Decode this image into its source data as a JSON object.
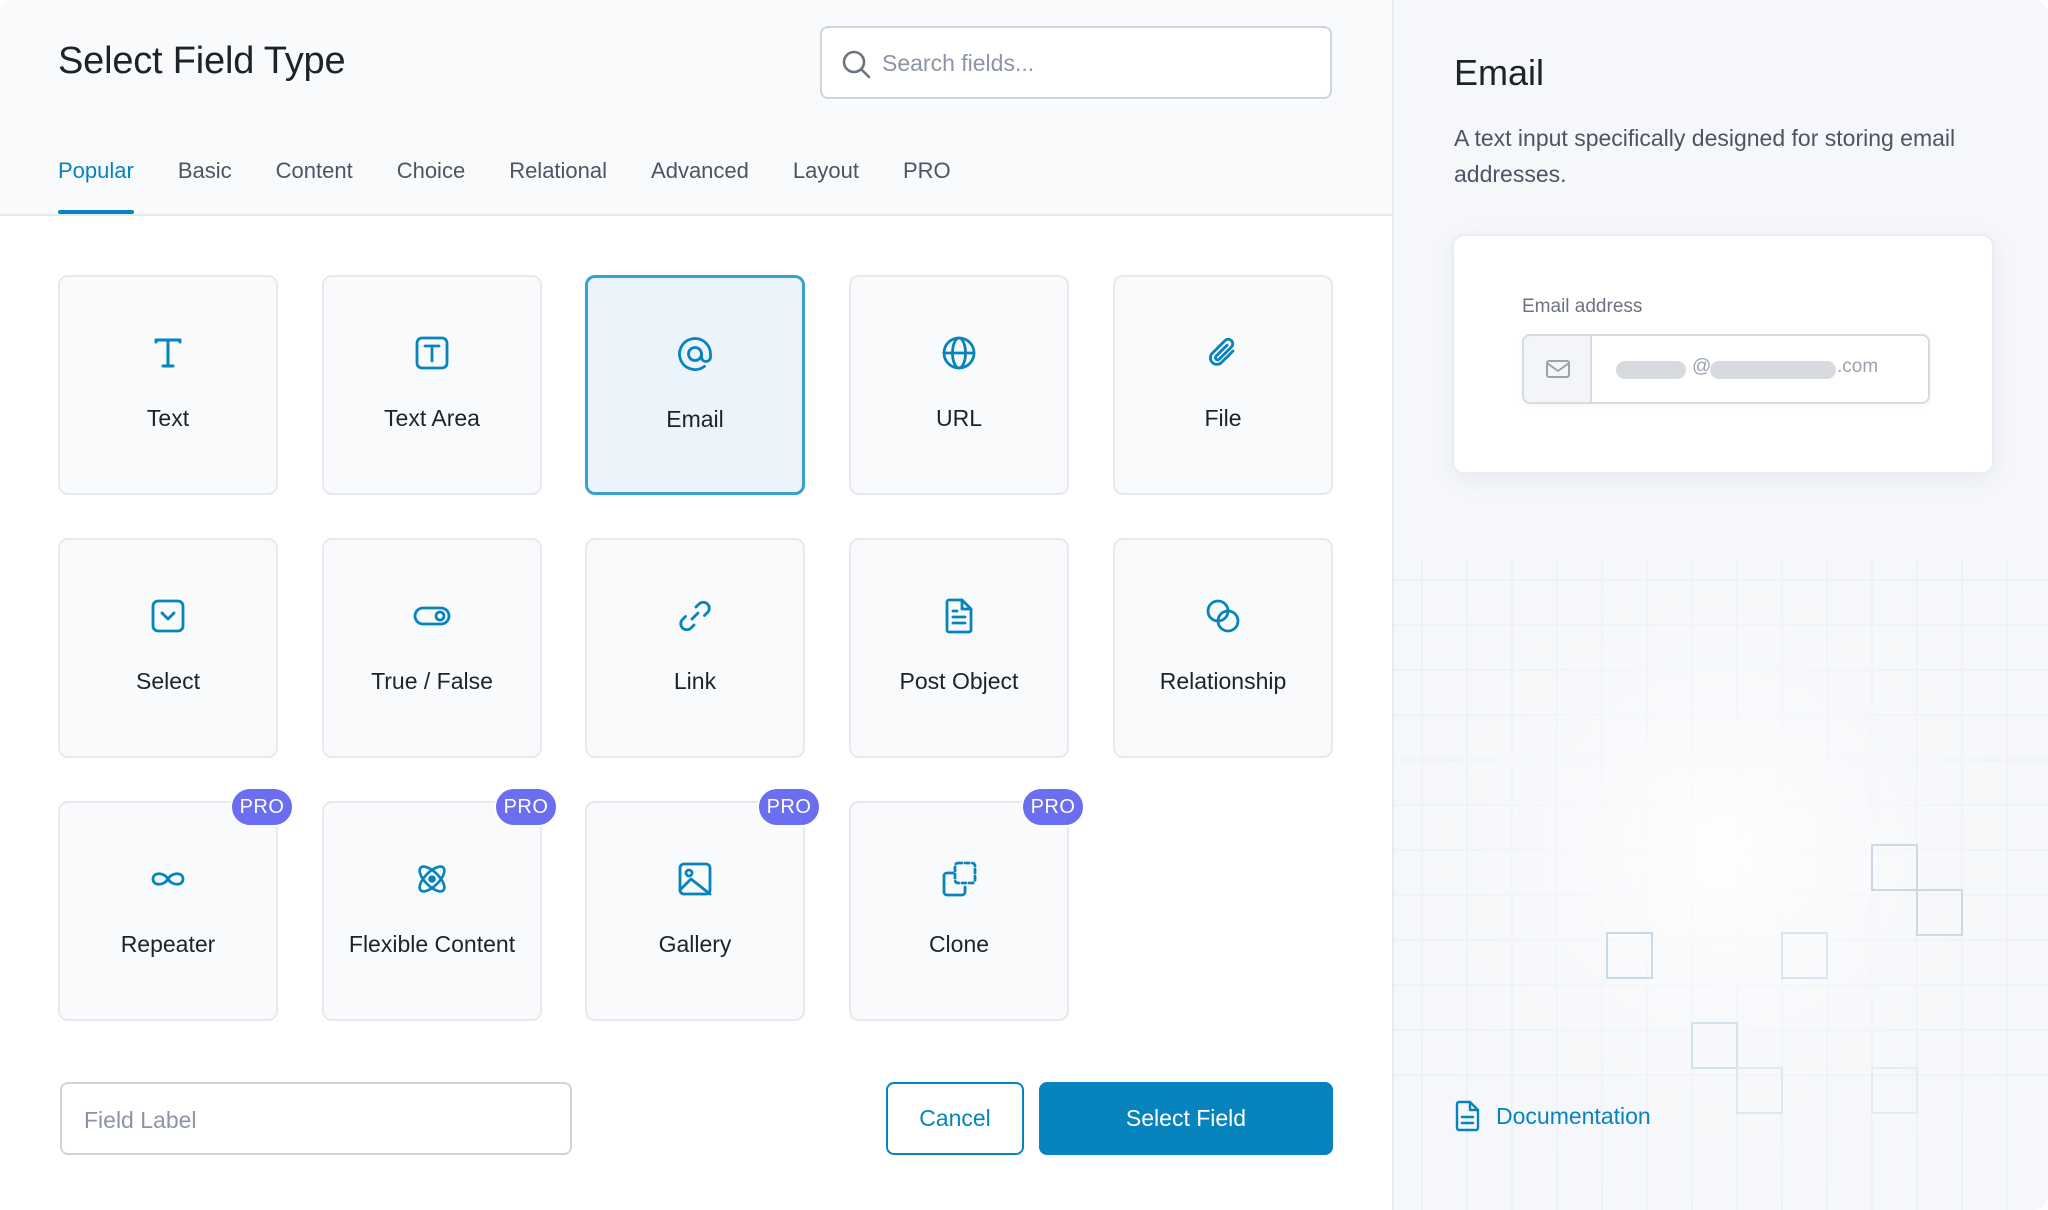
{
  "modal": {
    "title": "Select Field Type",
    "search": {
      "placeholder": "Search fields..."
    },
    "tabs": [
      {
        "label": "Popular",
        "active": true
      },
      {
        "label": "Basic"
      },
      {
        "label": "Content"
      },
      {
        "label": "Choice"
      },
      {
        "label": "Relational"
      },
      {
        "label": "Advanced"
      },
      {
        "label": "Layout"
      },
      {
        "label": "PRO"
      }
    ],
    "fields": [
      {
        "label": "Text",
        "icon": "text-icon"
      },
      {
        "label": "Text Area",
        "icon": "textarea-icon"
      },
      {
        "label": "Email",
        "icon": "at-icon",
        "selected": true
      },
      {
        "label": "URL",
        "icon": "globe-icon"
      },
      {
        "label": "File",
        "icon": "paperclip-icon"
      },
      {
        "label": "Select",
        "icon": "select-icon"
      },
      {
        "label": "True / False",
        "icon": "toggle-icon"
      },
      {
        "label": "Link",
        "icon": "link-icon"
      },
      {
        "label": "Post Object",
        "icon": "document-icon"
      },
      {
        "label": "Relationship",
        "icon": "relationship-icon"
      },
      {
        "label": "Repeater",
        "icon": "infinity-icon",
        "pro": true
      },
      {
        "label": "Flexible Content",
        "icon": "atom-icon",
        "pro": true
      },
      {
        "label": "Gallery",
        "icon": "image-icon",
        "pro": true
      },
      {
        "label": "Clone",
        "icon": "clone-icon",
        "pro": true
      }
    ],
    "pro_badge": "PRO",
    "footer": {
      "field_label_placeholder": "Field Label",
      "cancel_label": "Cancel",
      "select_label": "Select Field"
    }
  },
  "preview": {
    "title": "Email",
    "description": "A text input specifically designed for storing email addresses.",
    "field_label": "Email address",
    "input_at": "@",
    "input_suffix": ".com",
    "documentation_label": "Documentation"
  },
  "colors": {
    "accent": "#0783be",
    "pro_badge": "#6b6ef0",
    "selected_card_bg": "#ebf4fb",
    "selected_card_border": "#3aa0d0"
  }
}
